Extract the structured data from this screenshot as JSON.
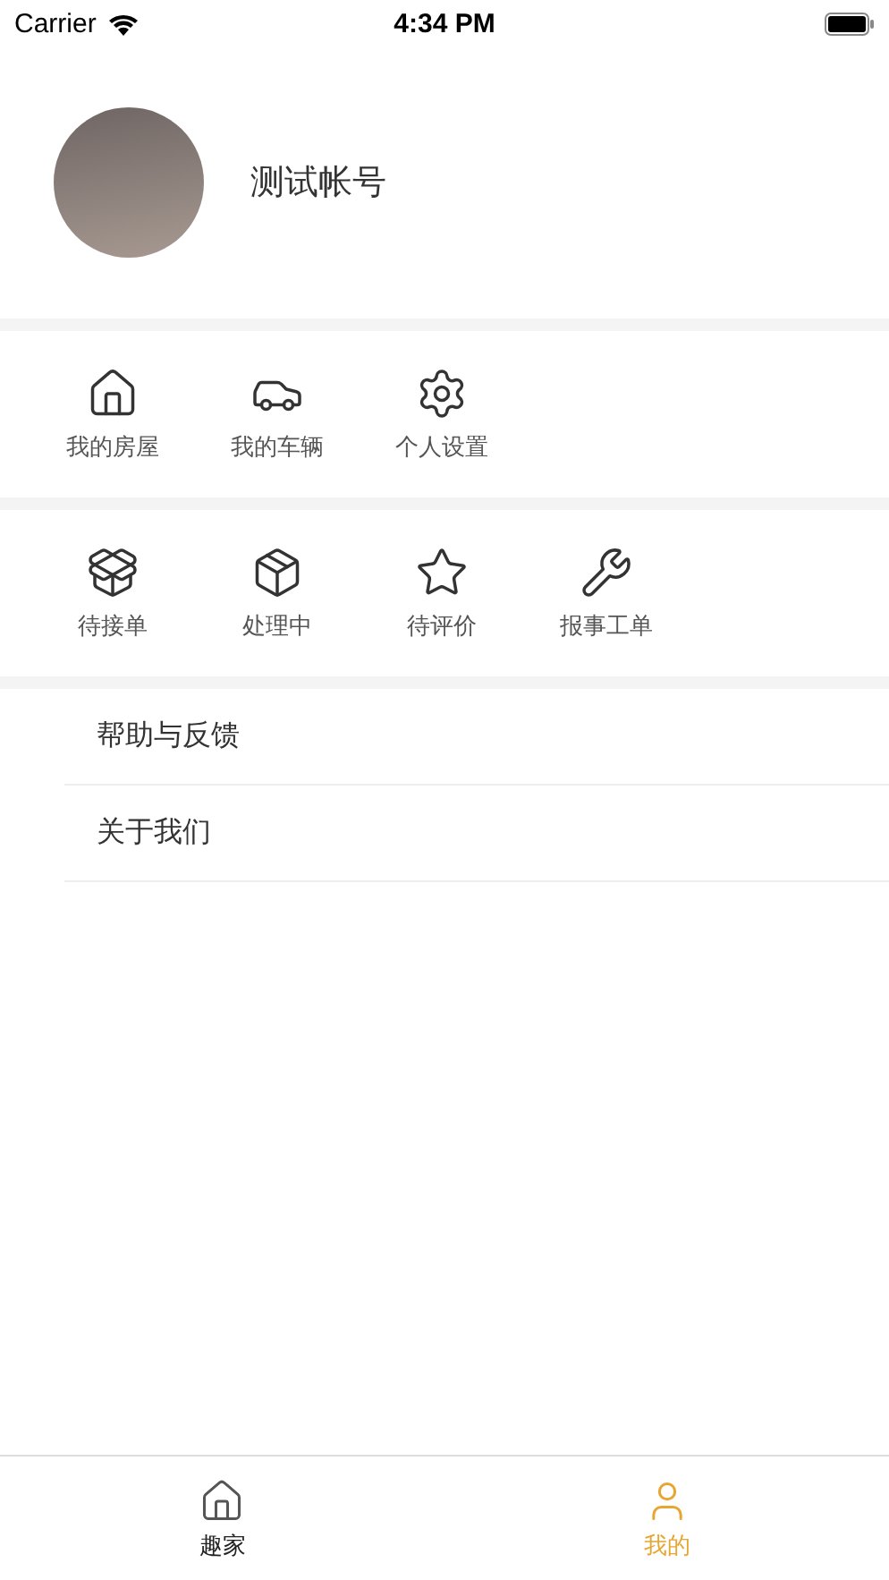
{
  "status_bar": {
    "carrier": "Carrier",
    "time": "4:34 PM"
  },
  "profile": {
    "name": "测试帐号"
  },
  "shortcuts": [
    {
      "label": "我的房屋"
    },
    {
      "label": "我的车辆"
    },
    {
      "label": "个人设置"
    }
  ],
  "orders": [
    {
      "label": "待接单"
    },
    {
      "label": "处理中"
    },
    {
      "label": "待评价"
    },
    {
      "label": "报事工单"
    }
  ],
  "menu": [
    {
      "label": "帮助与反馈"
    },
    {
      "label": "关于我们"
    }
  ],
  "tab_bar": [
    {
      "label": "趣家",
      "selected": false
    },
    {
      "label": "我的",
      "selected": true
    }
  ]
}
